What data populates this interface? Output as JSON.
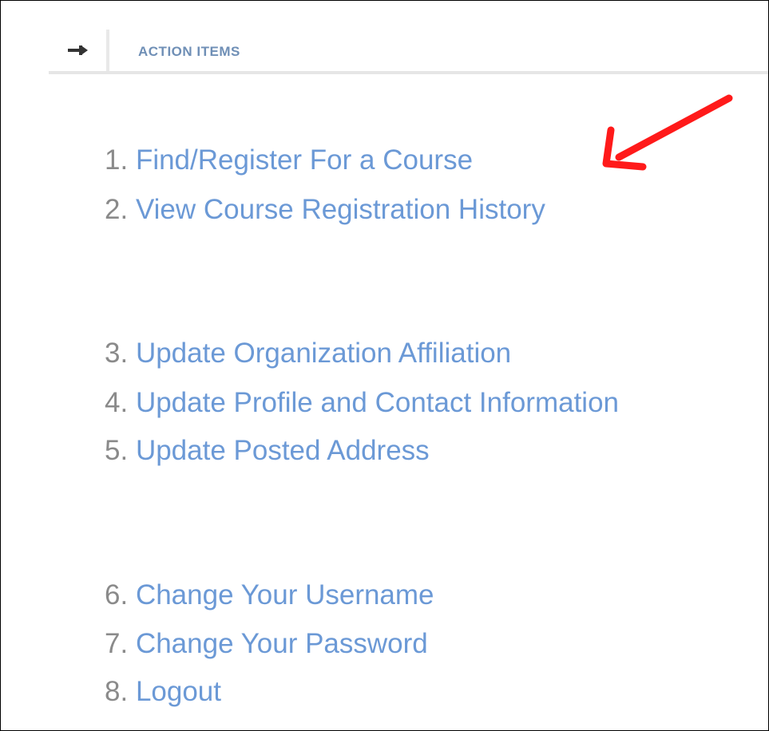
{
  "panel": {
    "title": "ACTION ITEMS",
    "pin_icon": "pin-arrow-icon"
  },
  "menu": {
    "items": [
      {
        "number": "1.",
        "label": "Find/Register For a Course"
      },
      {
        "number": "2.",
        "label": "View Course Registration History"
      },
      {
        "number": "3.",
        "label": "Update Organization Affiliation"
      },
      {
        "number": "4.",
        "label": "Update Profile and Contact Information"
      },
      {
        "number": "5.",
        "label": "Update Posted Address"
      },
      {
        "number": "6.",
        "label": "Change Your Username"
      },
      {
        "number": "7.",
        "label": "Change Your Password"
      },
      {
        "number": "8.",
        "label": "Logout"
      }
    ]
  },
  "annotation": {
    "arrow_icon": "red-arrow-icon",
    "arrow_color": "#ff1a1a"
  },
  "colors": {
    "link": "#6b99d6",
    "number": "#8a8a8a",
    "header_title": "#6f8fb6"
  }
}
